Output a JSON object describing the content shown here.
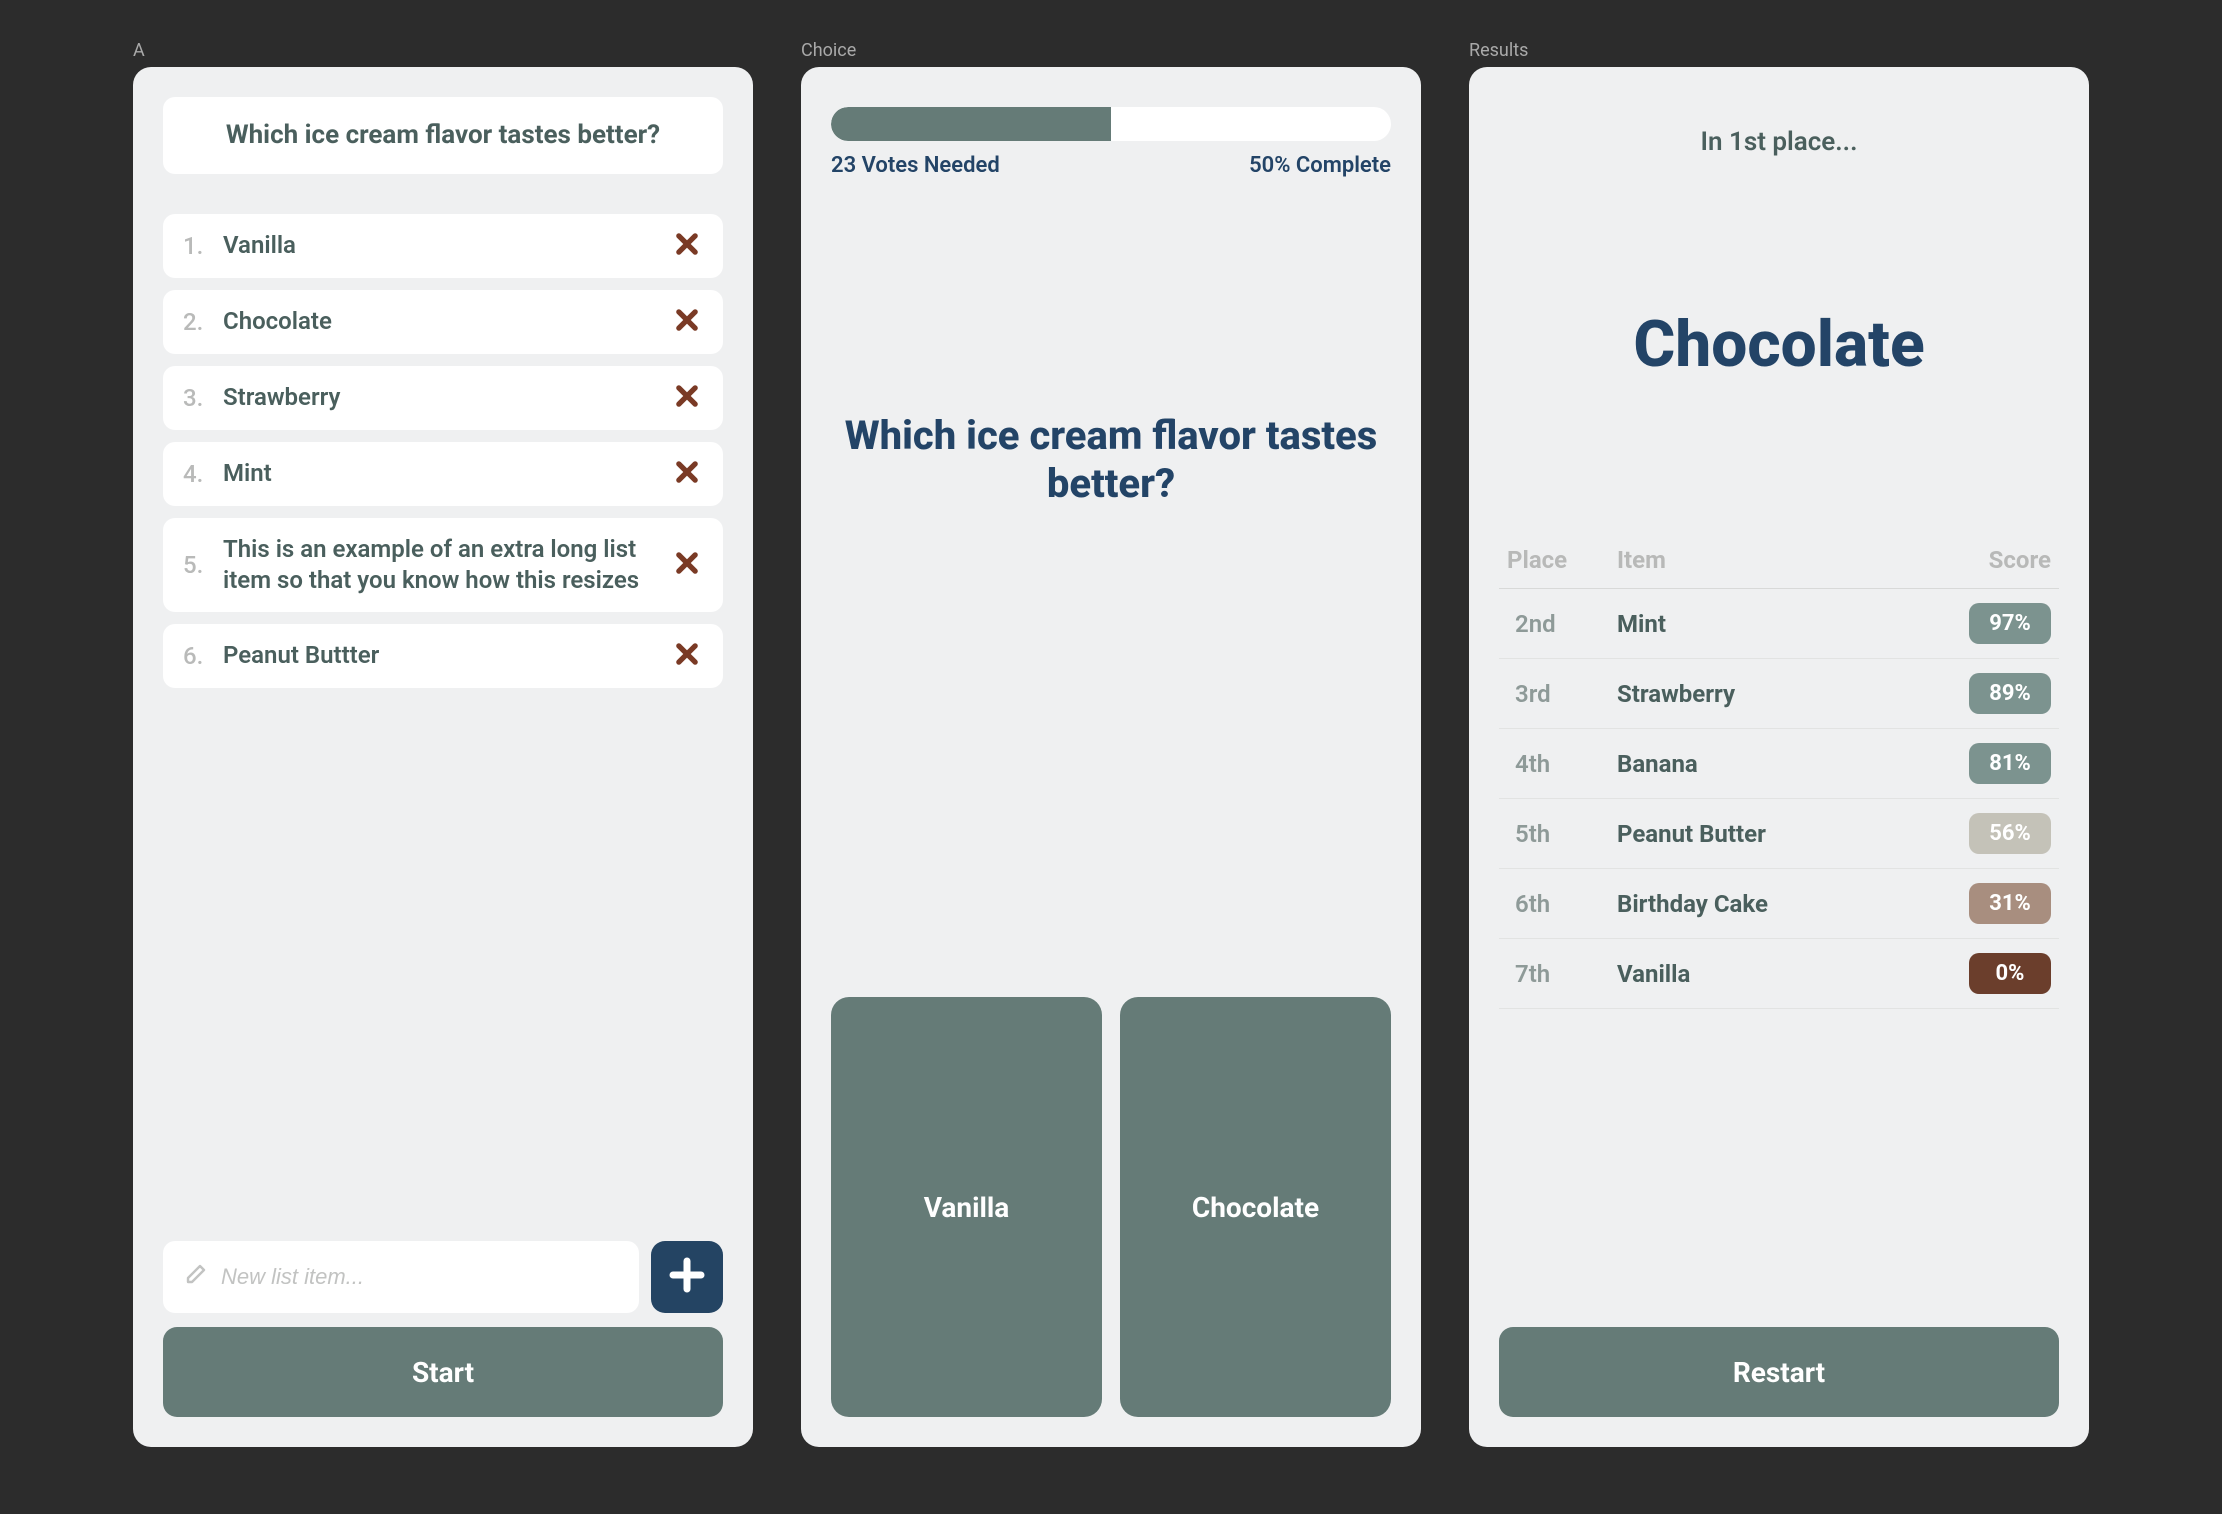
{
  "colors": {
    "accent_green": "#657b77",
    "accent_navy": "#234467",
    "danger_brown": "#7a3a25",
    "text_muted": "#4a5f5d"
  },
  "panelA": {
    "label": "A",
    "question": "Which ice cream flavor tastes better?",
    "items": [
      {
        "num": "1.",
        "text": "Vanilla"
      },
      {
        "num": "2.",
        "text": "Chocolate"
      },
      {
        "num": "3.",
        "text": "Strawberry"
      },
      {
        "num": "4.",
        "text": "Mint"
      },
      {
        "num": "5.",
        "text": "This is an example of an extra long list item so that you know how this resizes"
      },
      {
        "num": "6.",
        "text": "Peanut Buttter"
      }
    ],
    "new_item_placeholder": "New list item...",
    "start_label": "Start"
  },
  "panelB": {
    "label": "Choice",
    "progress_percent": 50,
    "votes_needed_text": "23 Votes Needed",
    "complete_text": "50% Complete",
    "question": "Which ice cream flavor tastes better?",
    "option_left": "Vanilla",
    "option_right": "Chocolate"
  },
  "panelC": {
    "label": "Results",
    "winner_intro": "In 1st place...",
    "winner_name": "Chocolate",
    "head_place": "Place",
    "head_item": "Item",
    "head_score": "Score",
    "rows": [
      {
        "place": "2nd",
        "item": "Mint",
        "score": "97%",
        "color": "#7c938f"
      },
      {
        "place": "3rd",
        "item": "Strawberry",
        "score": "89%",
        "color": "#7c938f"
      },
      {
        "place": "4th",
        "item": "Banana",
        "score": "81%",
        "color": "#7c938f"
      },
      {
        "place": "5th",
        "item": "Peanut Butter",
        "score": "56%",
        "color": "#c4c2b8"
      },
      {
        "place": "6th",
        "item": "Birthday Cake",
        "score": "31%",
        "color": "#a88e7f"
      },
      {
        "place": "7th",
        "item": "Vanilla",
        "score": "0%",
        "color": "#6b3e2c"
      }
    ],
    "restart_label": "Restart"
  }
}
